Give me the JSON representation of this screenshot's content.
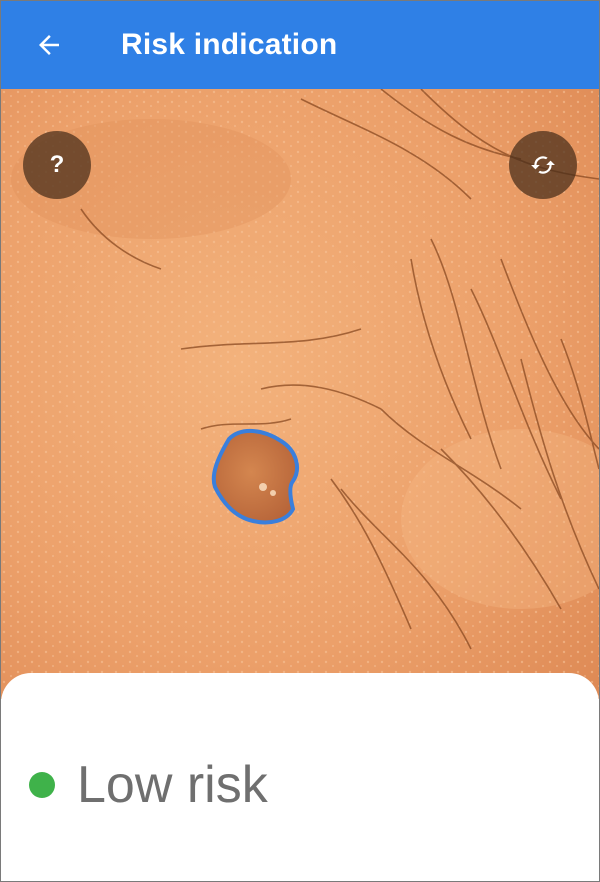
{
  "app_bar": {
    "title": "Risk indication",
    "back_icon": "arrow-left-icon",
    "background": "#2f80e6"
  },
  "photo": {
    "lesion_outline_color": "#3a7fdc"
  },
  "controls": {
    "help_label": "?",
    "help_icon": "question-icon",
    "rotate_icon": "rotate-icon"
  },
  "result": {
    "risk_label": "Low risk",
    "status_color": "#3fb24a"
  }
}
